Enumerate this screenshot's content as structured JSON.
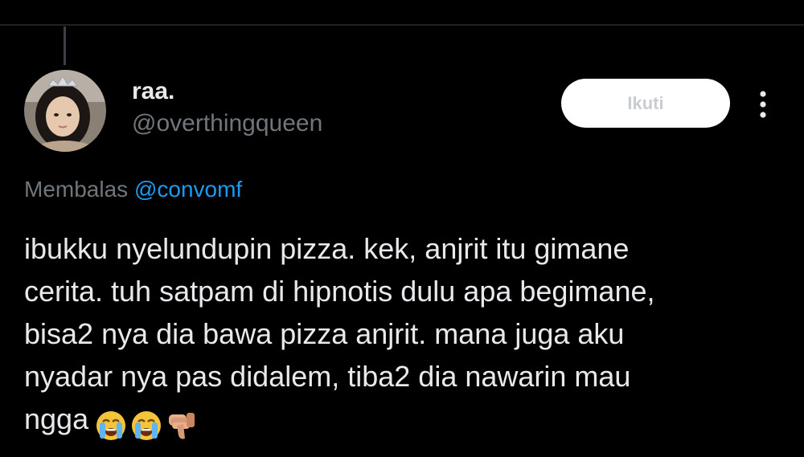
{
  "tweet": {
    "author": {
      "display_name": "raa.",
      "handle": "@overthingqueen"
    },
    "follow_button_label": "Ikuti",
    "reply_context": {
      "label": "Membalas",
      "mention": "@convomf"
    },
    "body_lines": [
      "ibukku nyelundupin pizza. kek, anjrit itu gimane",
      "cerita. tuh satpam di hipnotis dulu apa begimane,",
      "bisa2 nya dia bawa pizza anjrit. mana juga aku",
      "nyadar nya pas didalem, tiba2 dia nawarin mau",
      "ngga"
    ],
    "body_emojis": [
      "loudly-crying-face",
      "loudly-crying-face",
      "thumbs-down"
    ]
  },
  "colors": {
    "background": "#000000",
    "primary_text": "#e7e9ea",
    "secondary_text": "#71767b",
    "mention_blue": "#1d9bf0",
    "divider": "#1f2226"
  }
}
